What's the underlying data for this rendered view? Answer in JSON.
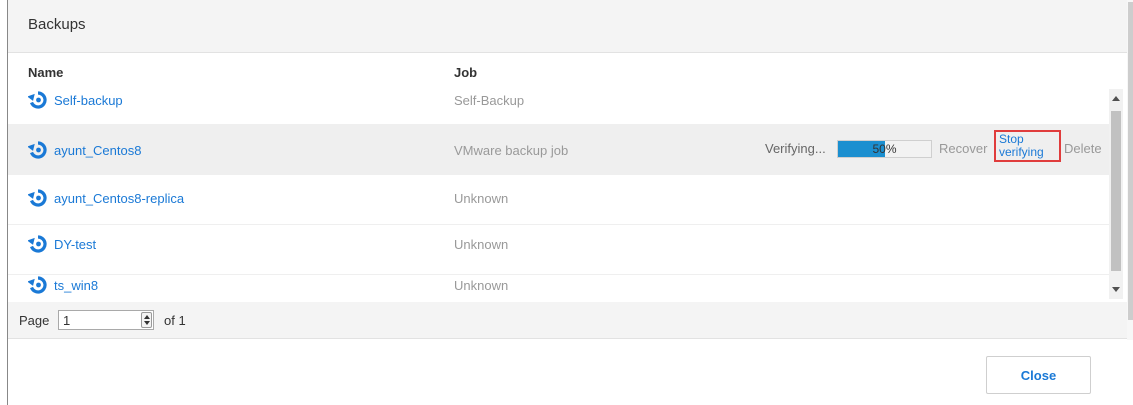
{
  "dialog": {
    "title": "Backups"
  },
  "table": {
    "columns": {
      "name": "Name",
      "job": "Job"
    },
    "rows": [
      {
        "name": "Self-backup",
        "job": "Self-Backup"
      },
      {
        "name": "ayunt_Centos8",
        "job": "VMware backup job",
        "status": "Verifying...",
        "progress": "50%",
        "progress_value": 0.5,
        "actions": {
          "recover": "Recover",
          "stop": "Stop verifying",
          "delete": "Delete"
        }
      },
      {
        "name": "ayunt_Centos8-replica",
        "job": "Unknown"
      },
      {
        "name": "DY-test",
        "job": "Unknown"
      },
      {
        "name": "ts_win8",
        "job": "Unknown"
      }
    ]
  },
  "pager": {
    "label": "Page",
    "value": "1",
    "of": "of 1"
  },
  "footer": {
    "close_label": "Close"
  },
  "colors": {
    "link": "#1a79d6",
    "progress": "#1b8fd0",
    "highlight": "#e03c3c",
    "icon": "#1a79d6"
  },
  "icons": {
    "row": "backup-restore-icon"
  }
}
